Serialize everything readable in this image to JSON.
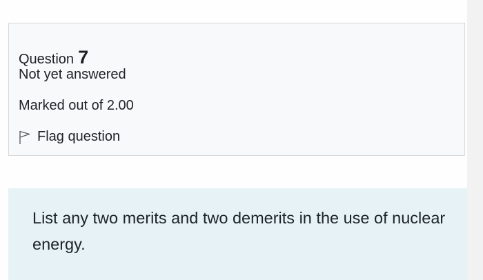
{
  "question_info": {
    "label": "Question",
    "number": "7",
    "state": "Not yet answered",
    "grade": "Marked out of 2.00",
    "flag_label": "Flag question"
  },
  "question": {
    "text": "List any two merits and two demerits in the use of nuclear energy."
  },
  "icons": {
    "flag": "flag-icon"
  },
  "colors": {
    "info_background": "#f8f9fa",
    "info_border": "#d6d8da",
    "question_background": "#e7f2f6",
    "text": "#1d2125"
  }
}
